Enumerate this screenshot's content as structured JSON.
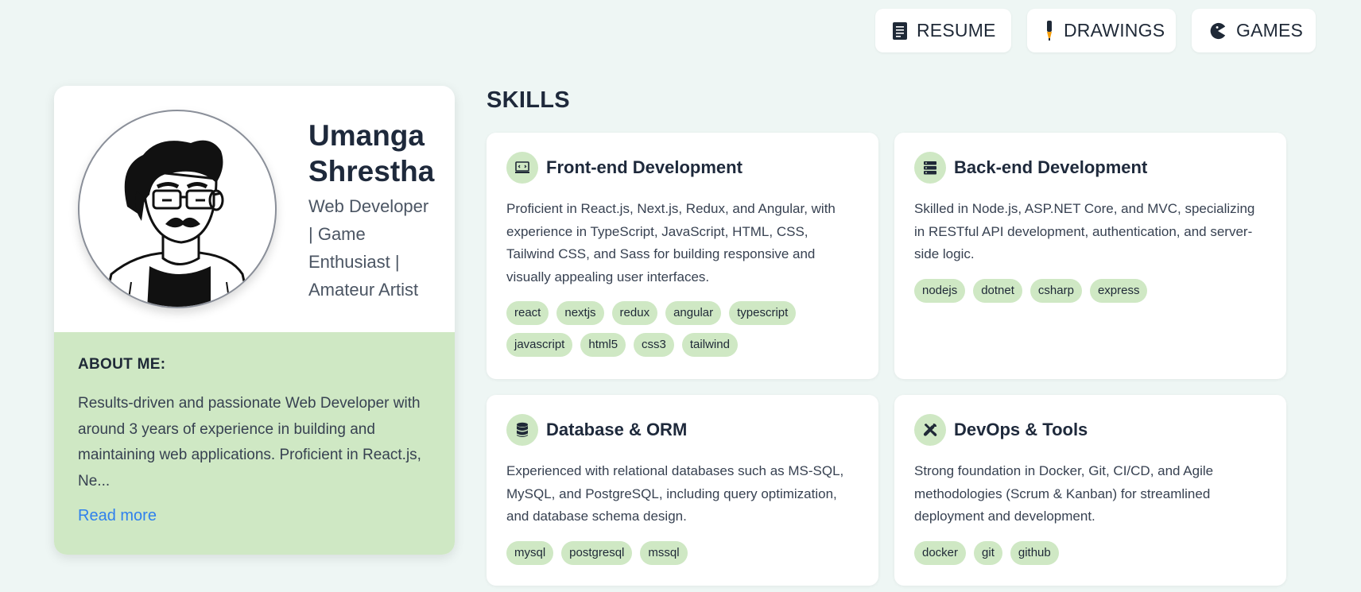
{
  "nav": {
    "resume": "RESUME",
    "drawings": "DRAWINGS",
    "games": "GAMES"
  },
  "profile": {
    "name_first": "Umanga",
    "name_last": "Shrestha",
    "role_lines": [
      "Web Developer",
      "| Game",
      "Enthusiast |",
      "Amateur Artist"
    ],
    "about_title": "ABOUT ME:",
    "about_text": "Results-driven and passionate Web Developer with around 3 years of experience in building and maintaining web applications. Proficient in React.js, Ne...",
    "read_more": "Read more"
  },
  "skills": {
    "title": "SKILLS",
    "cards": [
      {
        "title": "Front-end Development",
        "icon": "code-monitor-icon",
        "text": "Proficient in React.js, Next.js, Redux, and Angular, with experience in TypeScript, JavaScript, HTML, CSS, Tailwind CSS, and Sass for building responsive and visually appealing user interfaces.",
        "tags": [
          "react",
          "nextjs",
          "redux",
          "angular",
          "typescript",
          "javascript",
          "html5",
          "css3",
          "tailwind"
        ]
      },
      {
        "title": "Back-end Development",
        "icon": "server-icon",
        "text": "Skilled in Node.js, ASP.NET Core, and MVC, specializing in RESTful API development, authentication, and server-side logic.",
        "tags": [
          "nodejs",
          "dotnet",
          "csharp",
          "express"
        ]
      },
      {
        "title": "Database & ORM",
        "icon": "database-icon",
        "text": "Experienced with relational databases such as MS-SQL, MySQL, and PostgreSQL, including query optimization, and database schema design.",
        "tags": [
          "mysql",
          "postgresql",
          "mssql"
        ]
      },
      {
        "title": "DevOps & Tools",
        "icon": "tools-icon",
        "text": "Strong foundation in Docker, Git, CI/CD, and Agile methodologies (Scrum & Kanban) for streamlined deployment and development.",
        "tags": [
          "docker",
          "git",
          "github"
        ]
      }
    ]
  },
  "colors": {
    "background": "#eef6f4",
    "accent_green": "#cfe8c4",
    "link_blue": "#2f80ed",
    "text_dark": "#1e293b"
  }
}
